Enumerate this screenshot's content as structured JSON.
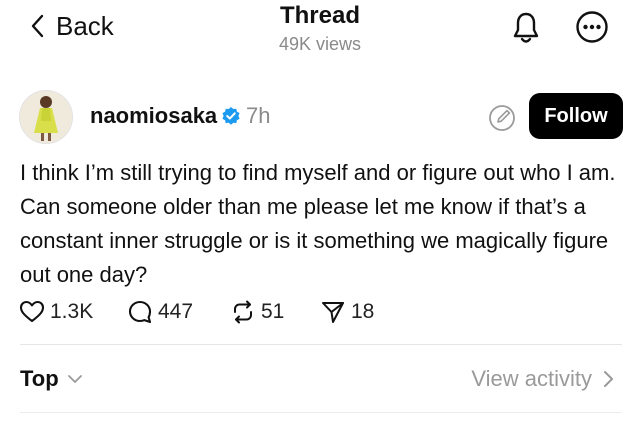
{
  "header": {
    "back_label": "Back",
    "title": "Thread",
    "views": "49K views"
  },
  "post": {
    "username": "naomiosaka",
    "time": "7h",
    "follow_label": "Follow",
    "text": "I think I’m still trying to find myself and or figure out who I am. Can someone older than me please let me know if that’s a constant inner struggle or is it something we magically figure out one day?",
    "stats": {
      "likes": "1.3K",
      "replies": "447",
      "reposts": "51",
      "shares": "18"
    }
  },
  "footer": {
    "sort_label": "Top",
    "view_activity_label": "View activity"
  },
  "icons": {
    "back": "chevron-left-icon",
    "bell": "bell-icon",
    "more": "more-icon",
    "verified": "verified-badge-icon",
    "edit": "edit-icon",
    "like": "heart-icon",
    "reply": "comment-icon",
    "repost": "repost-icon",
    "share": "send-icon"
  },
  "colors": {
    "verified": "#1d9bf0",
    "muted": "#8a8a8a",
    "button": "#000000"
  }
}
